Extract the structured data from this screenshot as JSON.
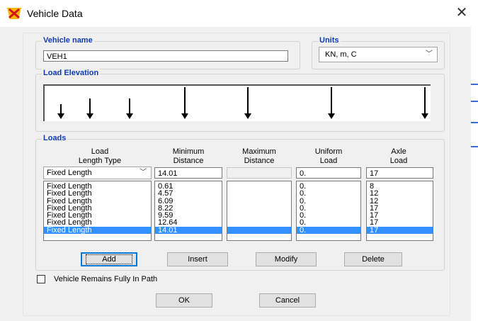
{
  "window": {
    "title": "Vehicle Data",
    "close_glyph": "✕"
  },
  "vehicle_name": {
    "label": "Vehicle name",
    "value": "VEH1"
  },
  "units": {
    "label": "Units",
    "value": "KN, m, C"
  },
  "load_elevation": {
    "label": "Load Elevation"
  },
  "loads": {
    "label": "Loads",
    "headers": {
      "length_type": [
        "Load",
        "Length Type"
      ],
      "min_distance": [
        "Minimum",
        "Distance"
      ],
      "max_distance": [
        "Maximum",
        "Distance"
      ],
      "uniform_load": [
        "Uniform",
        "Load"
      ],
      "axle_load": [
        "Axle",
        "Load"
      ]
    },
    "edit_row": {
      "length_type": "Fixed Length",
      "min_distance": "14.01",
      "max_distance": "",
      "uniform_load": "0.",
      "axle_load": "17"
    },
    "rows": [
      {
        "length_type": "Fixed Length",
        "min_distance": "0.61",
        "max_distance": "",
        "uniform_load": "0.",
        "axle_load": "8"
      },
      {
        "length_type": "Fixed Length",
        "min_distance": "4.57",
        "max_distance": "",
        "uniform_load": "0.",
        "axle_load": "12"
      },
      {
        "length_type": "Fixed Length",
        "min_distance": "6.09",
        "max_distance": "",
        "uniform_load": "0.",
        "axle_load": "12"
      },
      {
        "length_type": "Fixed Length",
        "min_distance": "8.22",
        "max_distance": "",
        "uniform_load": "0.",
        "axle_load": "17"
      },
      {
        "length_type": "Fixed Length",
        "min_distance": "9.59",
        "max_distance": "",
        "uniform_load": "0.",
        "axle_load": "17"
      },
      {
        "length_type": "Fixed Length",
        "min_distance": "12.64",
        "max_distance": "",
        "uniform_load": "0.",
        "axle_load": "17"
      },
      {
        "length_type": "Fixed Length",
        "min_distance": "14.01",
        "max_distance": "",
        "uniform_load": "0.",
        "axle_load": "17"
      }
    ],
    "selected_index": 6
  },
  "buttons": {
    "add": "Add",
    "insert": "Insert",
    "modify": "Modify",
    "delete": "Delete",
    "ok": "OK",
    "cancel": "Cancel"
  },
  "remains_in_path": {
    "label": "Vehicle Remains Fully In Path",
    "checked": false
  },
  "icons": {
    "app": "csi-app-icon",
    "close": "close-icon",
    "dropdown": "chevron-down-icon",
    "load_arrow": "down-arrow-icon"
  },
  "colors": {
    "group_label": "#0e3bb8",
    "selection": "#3390ff",
    "accent": "#0078d7"
  }
}
